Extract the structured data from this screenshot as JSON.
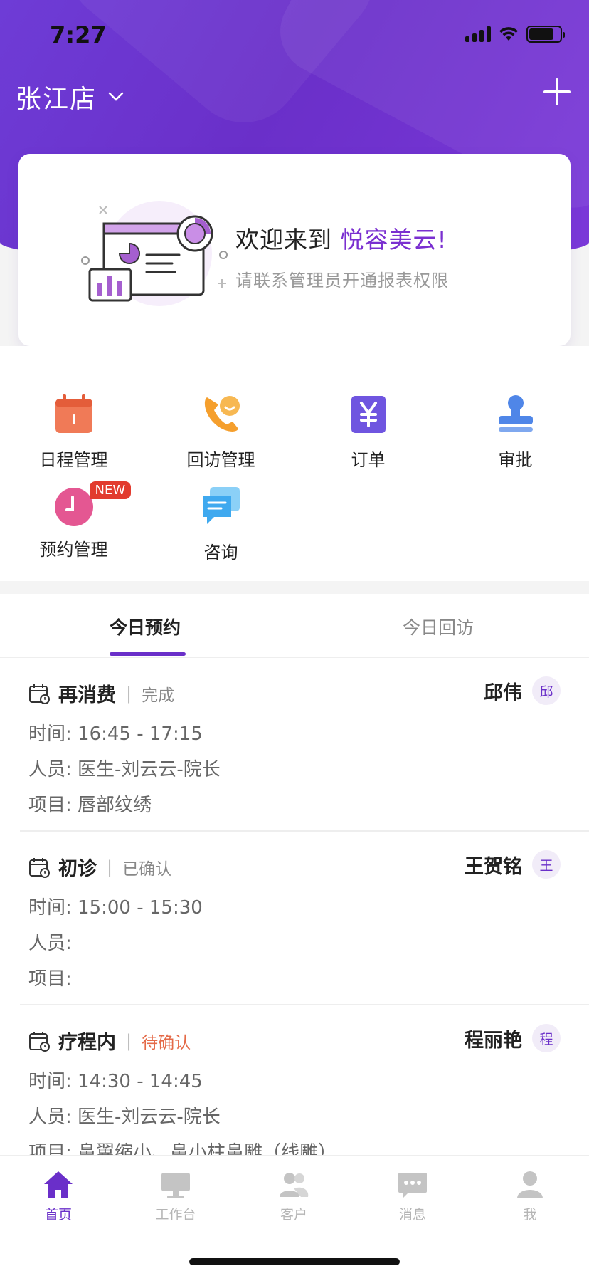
{
  "status_bar": {
    "time": "7:27"
  },
  "header": {
    "store_name": "张江店"
  },
  "welcome": {
    "title_prefix": "欢迎来到 ",
    "brand": "悦容美云!",
    "subtitle": "请联系管理员开通报表权限"
  },
  "menu": {
    "items": [
      {
        "label": "日程管理",
        "icon": "calendar-icon"
      },
      {
        "label": "回访管理",
        "icon": "phone-callback-icon"
      },
      {
        "label": "订单",
        "icon": "yen-order-icon"
      },
      {
        "label": "审批",
        "icon": "stamp-icon"
      },
      {
        "label": "预约管理",
        "icon": "clock-icon",
        "badge": "NEW"
      },
      {
        "label": "咨询",
        "icon": "chat-icon"
      }
    ]
  },
  "tabs": [
    {
      "label": "今日预约",
      "active": true
    },
    {
      "label": "今日回访",
      "active": false
    }
  ],
  "appointments": [
    {
      "type": "再消费",
      "status": "完成",
      "customer": "邱伟",
      "avatar": "邱",
      "time_label": "时间: 16:45 - 17:15",
      "staff_label": "人员: 医生-刘云云-院长",
      "project_label": "项目: 唇部纹绣"
    },
    {
      "type": "初诊",
      "status": "已确认",
      "customer": "王贺铭",
      "avatar": "王",
      "time_label": "时间: 15:00 - 15:30",
      "staff_label": "人员:",
      "project_label": "项目:"
    },
    {
      "type": "疗程内",
      "status": "待确认",
      "customer": "程丽艳",
      "avatar": "程",
      "time_label": "时间: 14:30 - 14:45",
      "staff_label": "人员: 医生-刘云云-院长",
      "project_label": "项目: 鼻翼缩小、鼻小柱鼻雕（线雕）"
    }
  ],
  "bottom_nav": [
    {
      "label": "首页",
      "icon": "home-icon",
      "active": true
    },
    {
      "label": "工作台",
      "icon": "workbench-icon",
      "active": false
    },
    {
      "label": "客户",
      "icon": "customers-icon",
      "active": false
    },
    {
      "label": "消息",
      "icon": "message-icon",
      "active": false
    },
    {
      "label": "我",
      "icon": "profile-icon",
      "active": false
    }
  ],
  "colors": {
    "primary": "#6a2fc9",
    "pending": "#e46a48",
    "badge": "#e23b2e"
  }
}
